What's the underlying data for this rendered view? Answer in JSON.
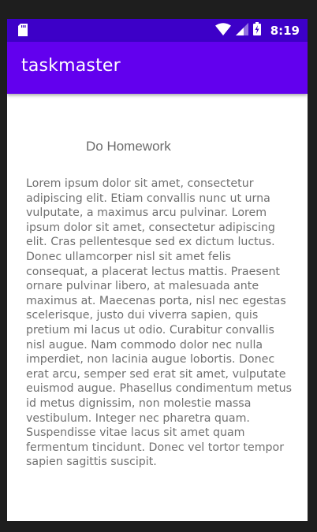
{
  "status_bar": {
    "time": "8:19",
    "icons": [
      "sd-card-icon",
      "wifi-icon",
      "signal-icon",
      "battery-charging-icon"
    ]
  },
  "app_bar": {
    "title": "taskmaster"
  },
  "task": {
    "title": "Do Homework",
    "description": "Lorem ipsum dolor sit amet, consectetur adipiscing elit. Etiam convallis nunc ut urna vulputate, a maximus arcu pulvinar. Lorem ipsum dolor sit amet, consectetur adipiscing elit. Cras pellentesque sed ex dictum luctus. Donec ullamcorper nisl sit amet felis consequat, a placerat lectus mattis. Praesent ornare pulvinar libero, at malesuada ante maximus at. Maecenas porta, nisl nec egestas scelerisque, justo dui viverra sapien, quis pretium mi lacus ut odio. Curabitur convallis nisl augue. Nam commodo dolor nec nulla imperdiet, non lacinia augue lobortis. Donec erat arcu, semper sed erat sit amet, vulputate euismod augue. Phasellus condimentum metus id metus dignissim, non molestie massa vestibulum. Integer nec pharetra quam. Suspendisse vitae lacus sit amet quam fermentum tincidunt. Donec vel tortor tempor sapien sagittis suscipit."
  },
  "colors": {
    "status_bar": "#3d00c8",
    "app_bar": "#6200ee",
    "text": "#707070",
    "background": "#ffffff"
  }
}
